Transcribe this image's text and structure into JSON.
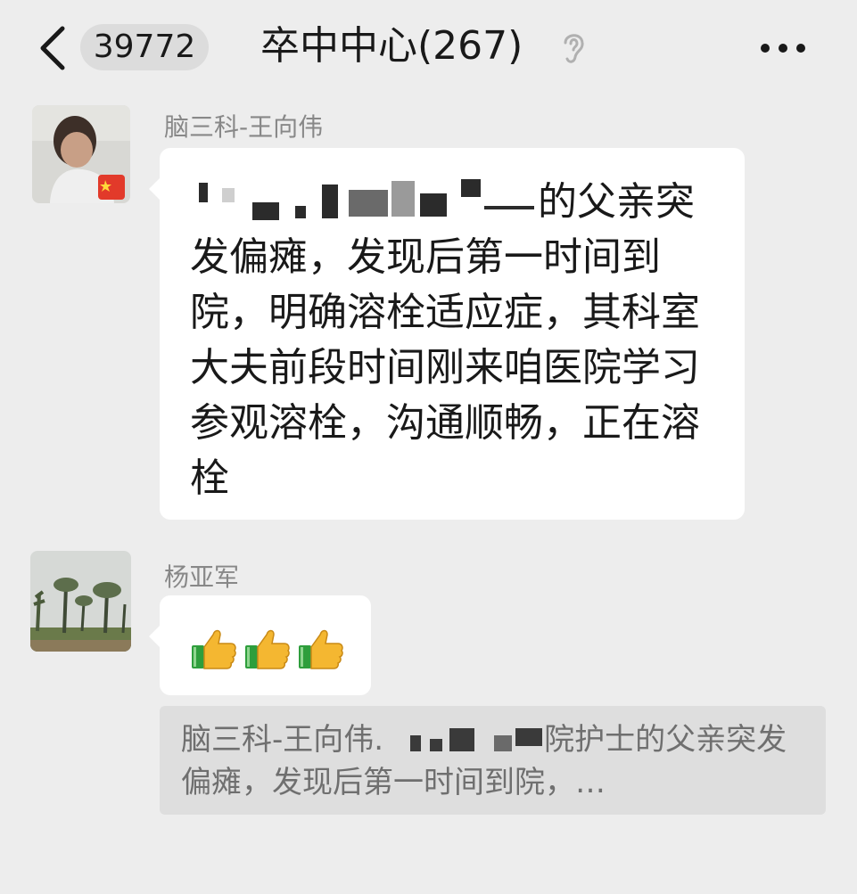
{
  "header": {
    "back_icon": "chevron-left-icon",
    "unread_count": "39772",
    "title": "卒中中心(267)",
    "ear_icon": "ear-icon",
    "more_icon": "more-dots-icon"
  },
  "messages": [
    {
      "sender": "脑三科-王向伟",
      "text_after_redaction": "的父亲突发偏瘫，发现后第一时间到院，明确溶栓适应症，其科室大夫前段时间刚来咱医院学习参观溶栓，沟通顺畅，正在溶栓"
    },
    {
      "sender": "杨亚军",
      "reaction": "thumbs-up x3"
    }
  ],
  "quote": {
    "prefix": "脑三科-王向伟.",
    "text": "院护士的父亲突发偏瘫，发现后第一时间到院，…"
  },
  "colors": {
    "background": "#ededed",
    "bubble": "#ffffff",
    "quote_bg": "#dedede",
    "thumbs_green": "#2e9e3c",
    "thumbs_yellow": "#f4b731"
  }
}
